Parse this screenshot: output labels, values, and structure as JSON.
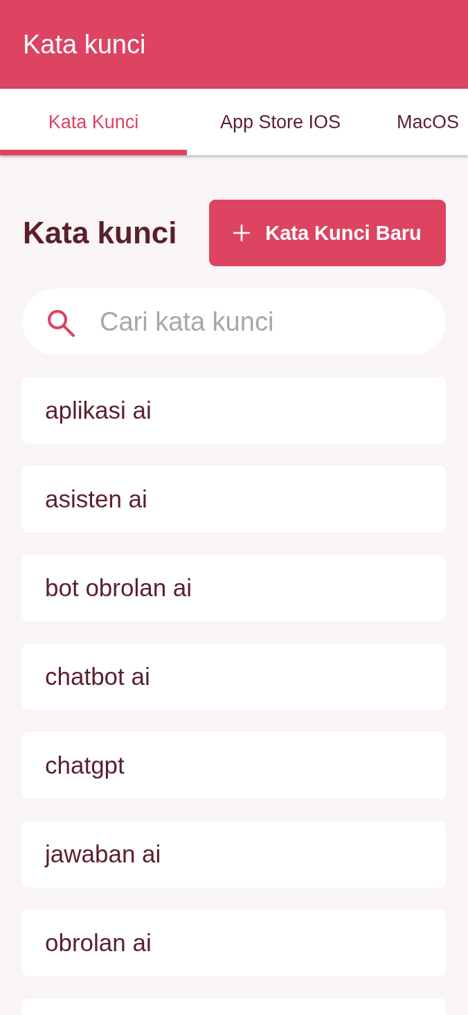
{
  "app_bar": {
    "title": "Kata kunci"
  },
  "tabs": [
    {
      "label": "Kata Kunci",
      "selected": true
    },
    {
      "label": "App Store IOS",
      "selected": false
    },
    {
      "label": "MacOS",
      "selected": false
    }
  ],
  "section": {
    "title": "Kata kunci",
    "add_button": "Kata Kunci Baru"
  },
  "search": {
    "placeholder": "Cari kata kunci"
  },
  "keywords": {
    "items": [
      "aplikasi ai",
      "asisten ai",
      "bot obrolan ai",
      "chatbot ai",
      "chatgpt",
      "jawaban ai",
      "obrolan ai"
    ],
    "more_below": true
  }
}
